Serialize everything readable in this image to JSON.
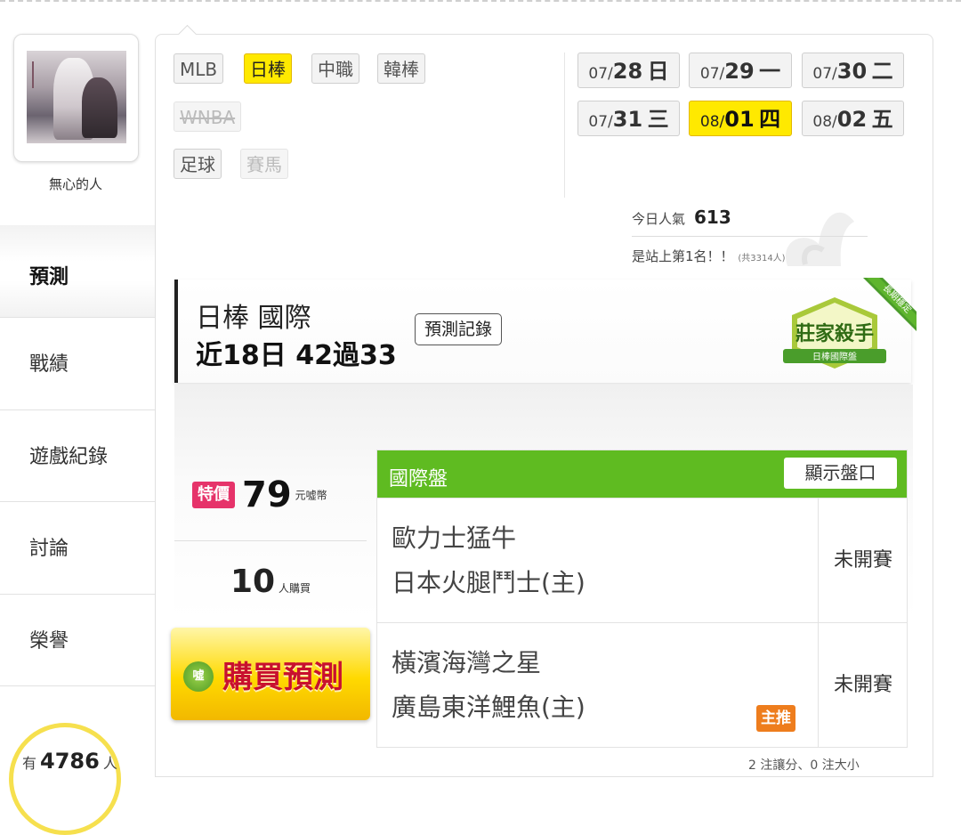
{
  "user": {
    "name": "無心的人"
  },
  "sidebar": {
    "items": [
      {
        "label": "預測",
        "active": true
      },
      {
        "label": "戰績"
      },
      {
        "label": "遊戲紀錄"
      },
      {
        "label": "討論"
      },
      {
        "label": "榮譽"
      }
    ],
    "count_prefix": "有",
    "count_value": "4786",
    "count_suffix": "人"
  },
  "leagues": {
    "row1": [
      "MLB",
      "日棒",
      "中職",
      "韓棒"
    ],
    "row2": [
      "WNBA"
    ],
    "row3": [
      "足球",
      "賽馬"
    ],
    "selected": "日棒",
    "disabled": [
      "WNBA",
      "賽馬"
    ]
  },
  "dates": [
    {
      "md": "07/",
      "day": "28",
      "wd": "日"
    },
    {
      "md": "07/",
      "day": "29",
      "wd": "一"
    },
    {
      "md": "07/",
      "day": "30",
      "wd": "二"
    },
    {
      "md": "07/",
      "day": "31",
      "wd": "三"
    },
    {
      "md": "08/",
      "day": "01",
      "wd": "四",
      "selected": true
    },
    {
      "md": "08/",
      "day": "02",
      "wd": "五"
    }
  ],
  "popularity": {
    "label": "今日人氣",
    "value": "613",
    "rank_text": "是站上第1名！！",
    "total": "(共3314人)"
  },
  "predict": {
    "title_line1": "日棒 國際",
    "title_line2": "近18日 42過33",
    "record_button": "預測記錄",
    "badge_main": "莊家殺手",
    "badge_sub": "日棒國際盤",
    "ribbon": "長期穩定"
  },
  "purchase": {
    "sale_tag": "特價",
    "price": "79",
    "price_unit": "元噓幣",
    "buyers": "10",
    "buyers_unit": "人購買",
    "buy_icon": "噓",
    "buy_button": "購買預測"
  },
  "table": {
    "title": "國際盤",
    "show_button": "顯示盤口",
    "rows": [
      {
        "away": "歐力士猛牛",
        "home": "日本火腿鬥士(主)",
        "status": "未開賽"
      },
      {
        "away": "橫濱海灣之星",
        "home": "廣島東洋鯉魚(主)",
        "status": "未開賽",
        "tag": "主推"
      }
    ],
    "footnote": "2 注讓分、0 注大小"
  },
  "colors": {
    "selected": "#ffe900",
    "table_header": "#5fbb21",
    "sale": "#e6336a",
    "main_tag": "#ee7d1d",
    "buy_text": "#c8102e"
  }
}
